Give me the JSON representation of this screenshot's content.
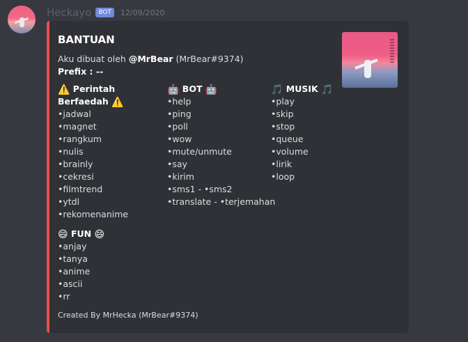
{
  "message": {
    "username": "Heckayo",
    "bot_tag": "BOT",
    "timestamp": "12/09/2020"
  },
  "embed": {
    "accent_color": "#e8504a",
    "title": "BANTUAN",
    "description": {
      "line1_prefix": "Aku dibuat oleh ",
      "line1_mention": "@MrBear",
      "line1_suffix": " (MrBear#9374)",
      "line2": "Prefix : --"
    },
    "fields": [
      {
        "key": "perintah",
        "name_emoji": "⚠️",
        "name": "Perintah Berfaedah",
        "name_emoji_end": "⚠️",
        "items": [
          "•jadwal",
          "•magnet",
          "•rangkum",
          "•nulis",
          "•brainly",
          "•cekresi",
          "•filmtrend",
          "•ytdl",
          "•rekomenanime"
        ]
      },
      {
        "key": "bot",
        "name_emoji": "🤖",
        "name": "BOT",
        "name_emoji_end": "🤖",
        "items": [
          "•help",
          "•ping",
          "•poll",
          "•wow",
          "•mute/unmute",
          "•say",
          "•kirim",
          "•sms1 - •sms2",
          "•translate - •terjemahan"
        ]
      },
      {
        "key": "musik",
        "name_emoji": "🎵",
        "name": "MUSIK",
        "name_emoji_end": "🎵",
        "items": [
          "•play",
          "•skip",
          "•stop",
          "•queue",
          "•volume",
          "•lirik",
          "•loop"
        ]
      },
      {
        "key": "fun",
        "name_emoji": "😄",
        "name": "FUN",
        "name_emoji_end": "😄",
        "items": [
          "•anjay",
          "•tanya",
          "•anime",
          "•ascii",
          "•rr"
        ]
      }
    ],
    "footer": "Created By MrHecka (MrBear#9374)"
  }
}
